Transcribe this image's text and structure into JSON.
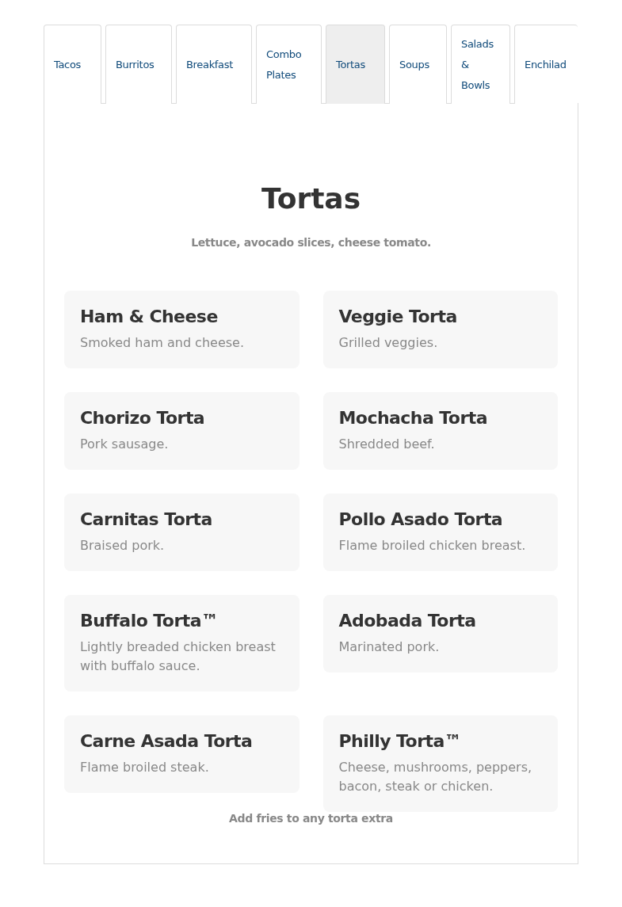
{
  "tabs": [
    {
      "label": "Tacos",
      "selected": false
    },
    {
      "label": "Burritos",
      "selected": false
    },
    {
      "label": "Breakfast",
      "selected": false
    },
    {
      "label": "Combo Plates",
      "selected": false
    },
    {
      "label": "Tortas",
      "selected": true
    },
    {
      "label": "Soups",
      "selected": false
    },
    {
      "label": "Salads & Bowls",
      "selected": false
    },
    {
      "label": "Enchilad",
      "selected": false
    }
  ],
  "section": {
    "title": "Tortas",
    "subtitle": "Lettuce, avocado slices, cheese tomato.",
    "items": [
      {
        "name": "Ham & Cheese",
        "description": "Smoked ham and cheese."
      },
      {
        "name": "Veggie Torta",
        "description": "Grilled veggies."
      },
      {
        "name": "Chorizo Torta",
        "description": "Pork sausage."
      },
      {
        "name": "Mochacha Torta",
        "description": "Shredded beef."
      },
      {
        "name": "Carnitas Torta",
        "description": "Braised pork."
      },
      {
        "name": "Pollo Asado Torta",
        "description": "Flame broiled chicken breast."
      },
      {
        "name": "Buffalo Torta™",
        "description": "Lightly breaded chicken breast with buffalo sauce."
      },
      {
        "name": "Adobada Torta",
        "description": "Marinated pork."
      },
      {
        "name": "Carne Asada Torta",
        "description": "Flame broiled steak."
      },
      {
        "name": "Philly Torta™",
        "description": "Cheese, mushrooms, peppers, bacon, steak or chicken."
      }
    ],
    "note": "Add fries to any torta extra"
  }
}
